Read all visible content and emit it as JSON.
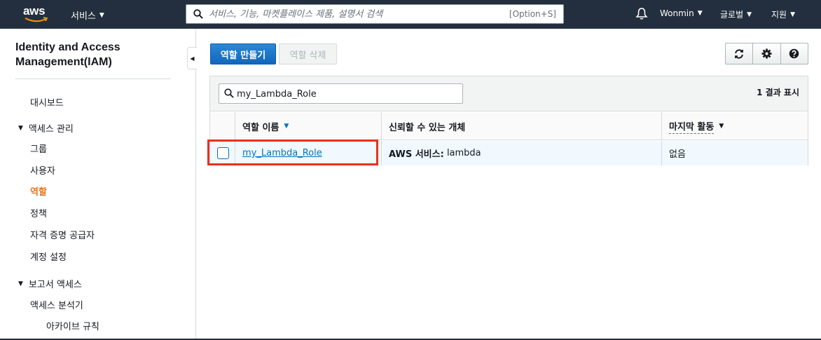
{
  "topnav": {
    "logo_text": "aws",
    "services_label": "서비스",
    "search_placeholder": "서비스, 기능, 마켓플레이스 제품, 설명서 검색",
    "search_shortcut": "[Option+S]",
    "user_label": "Wonmin",
    "region_label": "글로벌",
    "support_label": "지원"
  },
  "sidebar": {
    "title_line1": "Identity and Access",
    "title_line2": "Management(IAM)",
    "dashboard": "대시보드",
    "access_mgmt_section": "액세스 관리",
    "access_items": [
      "그룹",
      "사용자",
      "역할",
      "정책",
      "자격 증명 공급자",
      "계정 설정"
    ],
    "active_item": "역할",
    "report_section": "보고서 액세스",
    "report_items": [
      "액세스 분석기"
    ],
    "report_subitems": [
      "아카이브 규칙"
    ]
  },
  "toolbar": {
    "create_role_label": "역할 만들기",
    "delete_role_label": "역할 삭제"
  },
  "table": {
    "filter_value": "my_Lambda_Role",
    "result_count": "1 결과 표시",
    "columns": [
      "역할 이름",
      "신뢰할 수 있는 개체",
      "마지막 활동"
    ],
    "rows": [
      {
        "role_name": "my_Lambda_Role",
        "trusted_prefix": "AWS 서비스:",
        "trusted_value": "lambda",
        "last_activity": "없음"
      }
    ]
  },
  "colors": {
    "nav_bg": "#232f3e",
    "primary_button": "#1166bb",
    "link": "#0073bb",
    "active_nav": "#ec7211",
    "highlight_box": "#e8311a"
  }
}
